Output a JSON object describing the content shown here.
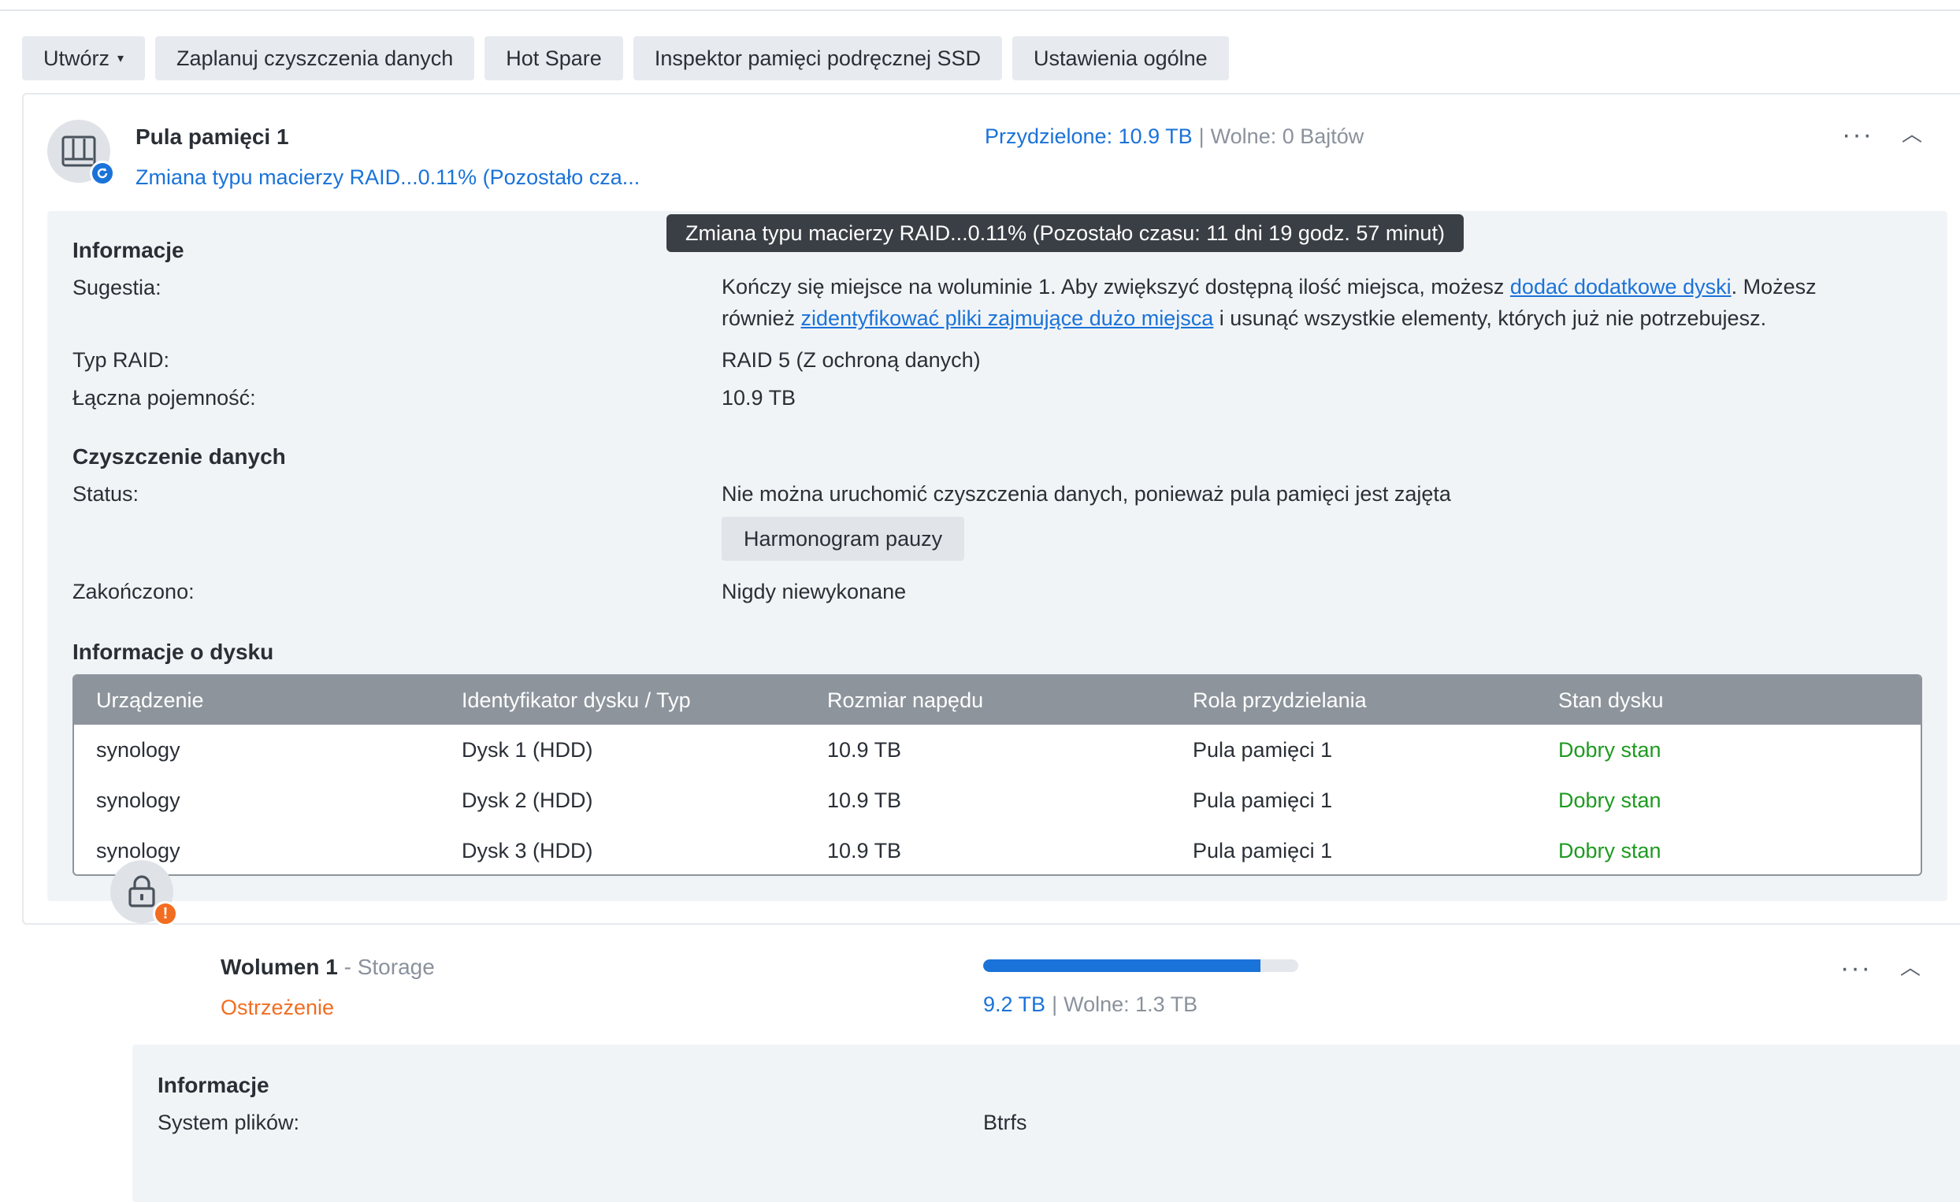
{
  "toolbar": {
    "create_label": "Utwórz",
    "schedule_label": "Zaplanuj czyszczenia danych",
    "hotspare_label": "Hot Spare",
    "ssd_label": "Inspektor pamięci podręcznej SSD",
    "settings_label": "Ustawienia ogólne"
  },
  "pool": {
    "title": "Pula pamięci 1",
    "status": "Zmiana typu macierzy RAID...0.11% (Pozostało cza...",
    "allocated": "Przydzielone: 10.9 TB",
    "free": "Wolne: 0 Bajtów",
    "tooltip": "Zmiana typu macierzy RAID...0.11% (Pozostało czasu: 11 dni 19 godz. 57 minut)",
    "info_heading": "Informacje",
    "suggestion_label": "Sugestia:",
    "suggestion_text_1": "Kończy się miejsce na woluminie 1. Aby zwiększyć dostępną ilość miejsca, możesz ",
    "suggestion_link_1": "dodać dodatkowe dyski",
    "suggestion_text_2": ". Możesz",
    "suggestion_text_3": "również ",
    "suggestion_link_2": "zidentyfikować pliki zajmujące dużo miejsca",
    "suggestion_text_4": " i usunąć wszystkie elementy, których już nie potrzebujesz.",
    "raid_label": "Typ RAID:",
    "raid_value": "RAID 5 (Z ochroną danych)",
    "capacity_label": "Łączna pojemność:",
    "capacity_value": "10.9 TB",
    "scrub_heading": "Czyszczenie danych",
    "status_label": "Status:",
    "status_value": "Nie można uruchomić czyszczenia danych, ponieważ pula pamięci jest zajęta",
    "pause_button": "Harmonogram pauzy",
    "finished_label": "Zakończono:",
    "finished_value": "Nigdy niewykonane",
    "disk_heading": "Informacje o dysku",
    "disk_table": {
      "headers": [
        "Urządzenie",
        "Identyfikator dysku / Typ",
        "Rozmiar napędu",
        "Rola przydzielania",
        "Stan dysku"
      ],
      "rows": [
        [
          "synology",
          "Dysk 1 (HDD)",
          "10.9 TB",
          "Pula pamięci 1",
          "Dobry stan"
        ],
        [
          "synology",
          "Dysk 2 (HDD)",
          "10.9 TB",
          "Pula pamięci 1",
          "Dobry stan"
        ],
        [
          "synology",
          "Dysk 3 (HDD)",
          "10.9 TB",
          "Pula pamięci 1",
          "Dobry stan"
        ]
      ]
    }
  },
  "volume": {
    "title": "Wolumen 1",
    "subtitle": "- Storage",
    "status": "Ostrzeżenie",
    "used": "9.2 TB",
    "free": "Wolne: 1.3 TB",
    "usage_fraction": 0.88,
    "info_heading": "Informacje",
    "fs_label": "System plików:",
    "fs_value": "Btrfs"
  },
  "colors": {
    "accent": "#1a73d9",
    "good": "#1e9a20",
    "warning": "#f26d21"
  }
}
